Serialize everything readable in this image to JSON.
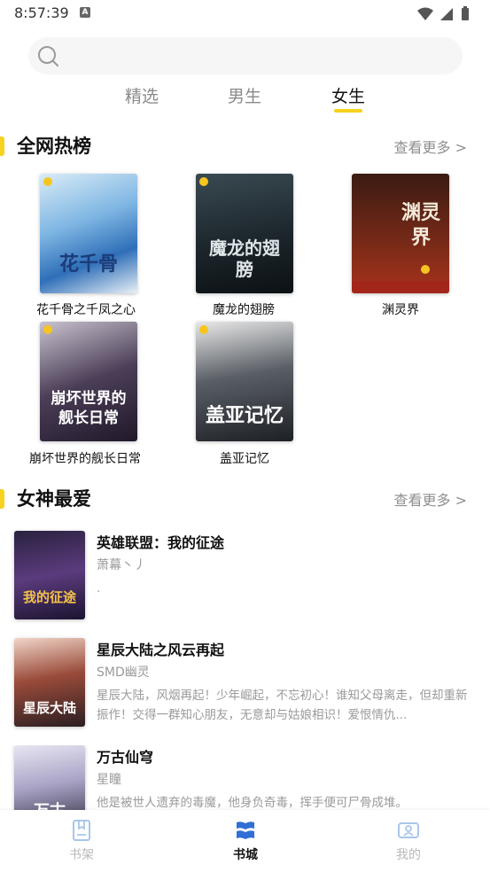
{
  "status_bar": {
    "time": "8:57:39",
    "notification_icon": "A"
  },
  "search": {
    "placeholder": ""
  },
  "tabs": [
    {
      "label": "精选",
      "active": false
    },
    {
      "label": "男生",
      "active": false
    },
    {
      "label": "女生",
      "active": true
    }
  ],
  "hot_list": {
    "title": "全网热榜",
    "see_more": "查看更多 >",
    "books": [
      {
        "title": "花千骨之千凤之心",
        "cover_text": "花千骨"
      },
      {
        "title": "魔龙的翅膀",
        "cover_text": "魔龙的翅膀"
      },
      {
        "title": "渊灵界",
        "cover_text": "渊灵界"
      },
      {
        "title": "崩坏世界的舰长日常",
        "cover_text": "崩坏世界的舰长日常"
      },
      {
        "title": "盖亚记忆",
        "cover_text": "盖亚记忆"
      }
    ]
  },
  "goddess_list": {
    "title": "女神最爱",
    "see_more": "查看更多 >",
    "books": [
      {
        "title": "英雄联盟：我的征途",
        "author": "萧幕丶丿",
        "desc": ".",
        "cover_text": "我的征途"
      },
      {
        "title": "星辰大陆之风云再起",
        "author": "SMD幽灵",
        "desc": "星辰大陆，风烟再起！少年崛起，不忘初心！谁知父母离走，但却重新振作！交得一群知心朋友，无意却与姑娘相识！爱恨情仇...",
        "cover_text": "星辰大陆"
      },
      {
        "title": "万古仙穹",
        "author": "星瞳",
        "desc": "他是被世人遗弃的毒魔，他身负奇毒，挥手便可尸骨成堆。",
        "cover_text": "万古"
      }
    ]
  },
  "bottom_nav": [
    {
      "label": "书架",
      "active": false
    },
    {
      "label": "书城",
      "active": true
    },
    {
      "label": "我的",
      "active": false
    }
  ],
  "colors": {
    "accent": "#f7d21e",
    "muted": "#9a9a9a"
  }
}
